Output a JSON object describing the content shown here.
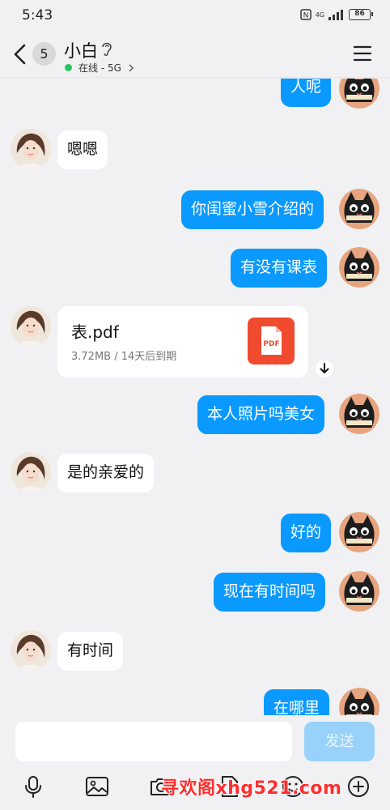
{
  "status_bar": {
    "time": "5:43",
    "signal_label": "4G",
    "battery": "86"
  },
  "header": {
    "unread_count": "5",
    "contact_name": "小白",
    "status_text": "在线 - 5G"
  },
  "messages": [
    {
      "side": "me",
      "text": "人呢"
    },
    {
      "side": "them",
      "text": "嗯嗯"
    },
    {
      "side": "me",
      "text": "你闺蜜小雪介绍的"
    },
    {
      "side": "me",
      "text": "有没有课表"
    },
    {
      "side": "them",
      "type": "file",
      "file_name": "表.pdf",
      "file_meta": "3.72MB / 14天后到期",
      "file_badge": "PDF"
    },
    {
      "side": "me",
      "text": "本人照片吗美女"
    },
    {
      "side": "them",
      "text": "是的亲爱的"
    },
    {
      "side": "me",
      "text": "好的"
    },
    {
      "side": "me",
      "text": "现在有时间吗"
    },
    {
      "side": "them",
      "text": "有时间"
    },
    {
      "side": "me",
      "text": "在哪里"
    }
  ],
  "input": {
    "value": "",
    "send_label": "发送"
  },
  "toolbar": [
    "mic-icon",
    "image-icon",
    "camera-icon",
    "file-icon",
    "emoji-icon",
    "plus-icon"
  ],
  "watermark": "寻欢阁xhg521.com",
  "colors": {
    "my_bubble": "#0a99ff",
    "their_bubble": "#ffffff",
    "online": "#22c55e",
    "pdf": "#f04b2e"
  }
}
